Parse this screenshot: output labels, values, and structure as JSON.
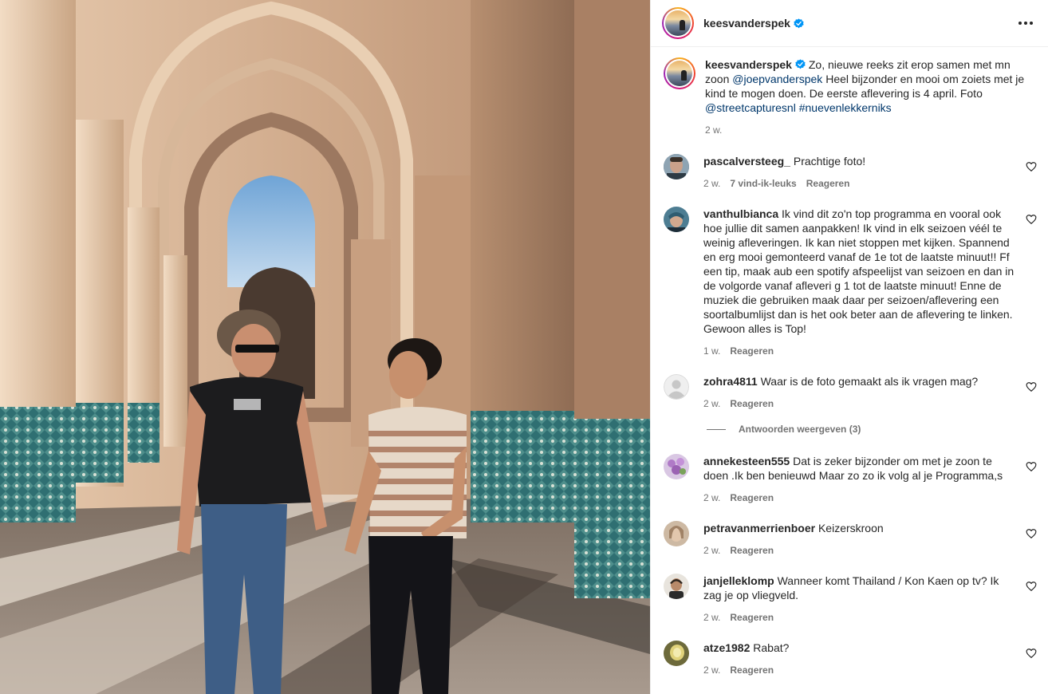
{
  "post": {
    "username": "keesvanderspek",
    "caption_parts": {
      "p1": "Zo, nieuwe reeks zit erop samen met mn zoon ",
      "mention1": "@joepvanderspek",
      "p2": " Heel bijzonder en mooi om zoiets met je kind te mogen doen. De eerste aflevering is 4 april. Foto ",
      "mention2": "@streetcapturesnl",
      "p3": " ",
      "hashtag": "#nuevenlekkerniks"
    },
    "time": "2 w."
  },
  "reply_label": "Reageren",
  "comments": [
    {
      "username": "pascalversteeg_",
      "text": "Prachtige foto!",
      "time": "2 w.",
      "likes": "7 vind-ik-leuks"
    },
    {
      "username": "vanthulbianca",
      "text": "Ik vind dit zo'n top programma en vooral ook hoe jullie dit samen aanpakken! Ik vind in elk seizoen véél te weinig afleveringen. Ik kan niet stoppen met kijken. Spannend en erg mooi gemonteerd vanaf de 1e tot de laatste minuut!! Ff een tip, maak aub een spotify afspeelijst van seizoen en dan in de volgorde vanaf afleveri g 1 tot de laatste minuut! Enne de muziek die gebruiken maak daar per seizoen/aflevering een soortalbumlijst dan is het ook beter aan de aflevering te linken. Gewoon alles is Top!",
      "time": "1 w."
    },
    {
      "username": "zohra4811",
      "text": "Waar is de foto gemaakt als ik vragen mag?",
      "time": "2 w."
    },
    {
      "username": "annekesteen555",
      "text": "Dat is zeker bijzonder om met je zoon te doen .Ik ben benieuwd Maar zo zo ik volg al je Programma,s",
      "time": "2 w."
    },
    {
      "username": "petravanmerrienboer",
      "text": "Keizerskroon",
      "time": "2 w."
    },
    {
      "username": "janjelleklomp",
      "text": "Wanneer komt Thailand / Kon Kaen op tv? Ik zag je op vliegveld.",
      "time": "2 w."
    },
    {
      "username": "atze1982",
      "text": "Rabat?",
      "time": "2 w."
    }
  ],
  "view_replies": "Antwoorden weergeven (3)",
  "icons": {
    "verified": "verified-badge-icon",
    "more": "more-options-icon",
    "like": "heart-icon"
  },
  "colors": {
    "link": "#00376b",
    "verified": "#0095f6",
    "muted": "#737373"
  }
}
